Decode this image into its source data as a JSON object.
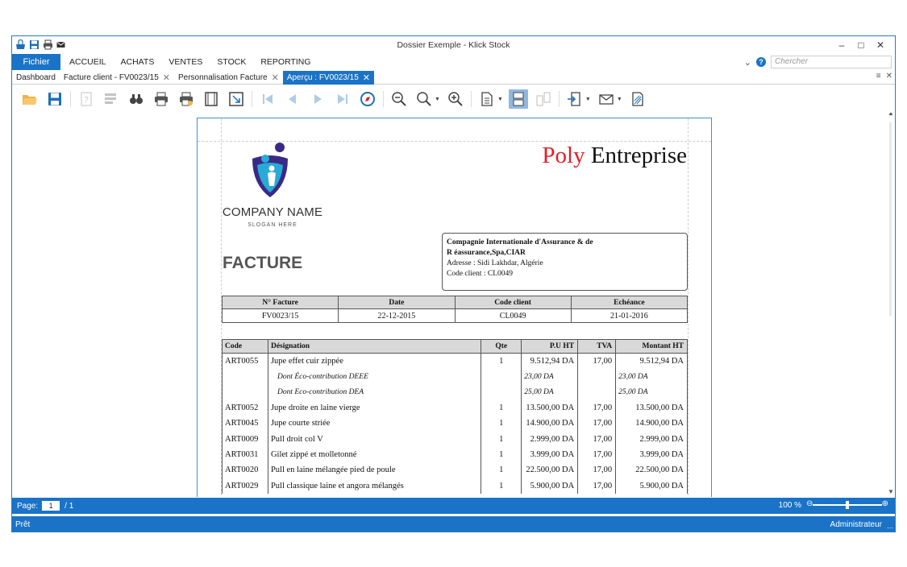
{
  "window": {
    "title": "Dossier Exemple - Klick Stock"
  },
  "menu": {
    "fichier": "Fichier",
    "items": [
      "ACCUEIL",
      "ACHATS",
      "VENTES",
      "STOCK",
      "REPORTING"
    ],
    "search_placeholder": "Chercher"
  },
  "tabs": [
    {
      "label": "Dashboard"
    },
    {
      "label": "Facture client - FV0023/15"
    },
    {
      "label": "Personnalisation Facture"
    },
    {
      "label": "Aperçu : FV0023/15"
    }
  ],
  "invoice": {
    "company_name": "COMPANY NAME",
    "slogan": "SLOGAN HERE",
    "brand_red": "Poly",
    "brand_black": " Entreprise",
    "title": "FACTURE",
    "client": {
      "name_line1": "Compagnie Internationale d'Assurance & de",
      "name_line2": "R éassurance,Spa,CIAR",
      "address": "Adresse : Sidi Lakhdar, Algérie",
      "code": "Code client : CL0049"
    },
    "header": {
      "columns": [
        "N° Facture",
        "Date",
        "Code client",
        "Echéance"
      ],
      "values": [
        "FV0023/15",
        "22-12-2015",
        "CL0049",
        "21-01-2016"
      ]
    },
    "lines": {
      "columns": [
        "Code",
        "Désignation",
        "Qte",
        "P.U HT",
        "TVA",
        "Montant HT"
      ],
      "rows": [
        {
          "code": "ART0055",
          "designation": "Jupe effet cuir zippée",
          "qte": "1",
          "pu": "9.512,94 DA",
          "tva": "17,00",
          "montant": "9.512,94 DA",
          "sub": false
        },
        {
          "code": "",
          "designation": "Dont Éco-contribution DEEE",
          "qte": "",
          "pu": "23,00 DA",
          "tva": "",
          "montant": "23,00 DA",
          "sub": true
        },
        {
          "code": "",
          "designation": "Dont Eco-contribution DEA",
          "qte": "",
          "pu": "25,00 DA",
          "tva": "",
          "montant": "25,00 DA",
          "sub": true
        },
        {
          "code": "ART0052",
          "designation": "Jupe droite en laine vierge",
          "qte": "1",
          "pu": "13.500,00 DA",
          "tva": "17,00",
          "montant": "13.500,00 DA",
          "sub": false
        },
        {
          "code": "ART0045",
          "designation": "Jupe courte striée",
          "qte": "1",
          "pu": "14.900,00 DA",
          "tva": "17,00",
          "montant": "14.900,00 DA",
          "sub": false
        },
        {
          "code": "ART0009",
          "designation": "Pull droit col V",
          "qte": "1",
          "pu": "2.999,00 DA",
          "tva": "17,00",
          "montant": "2.999,00 DA",
          "sub": false
        },
        {
          "code": "ART0031",
          "designation": "Gilet zippé et molletonné",
          "qte": "1",
          "pu": "3.999,00 DA",
          "tva": "17,00",
          "montant": "3.999,00 DA",
          "sub": false
        },
        {
          "code": "ART0020",
          "designation": "Pull en laine mélangée pied de poule",
          "qte": "1",
          "pu": "22.500,00 DA",
          "tva": "17,00",
          "montant": "22.500,00 DA",
          "sub": false
        },
        {
          "code": "ART0029",
          "designation": "Pull classique laine et angora mélangés",
          "qte": "1",
          "pu": "5.900,00 DA",
          "tva": "17,00",
          "montant": "5.900,00 DA",
          "sub": false
        }
      ]
    }
  },
  "pagebar": {
    "label": "Page:",
    "current": "1",
    "total": "/ 1",
    "zoom": "100 %"
  },
  "status": {
    "left": "Prêt",
    "right": "Administrateur"
  },
  "colors": {
    "accent": "#1a73c7",
    "brand_red": "#e31e24"
  }
}
